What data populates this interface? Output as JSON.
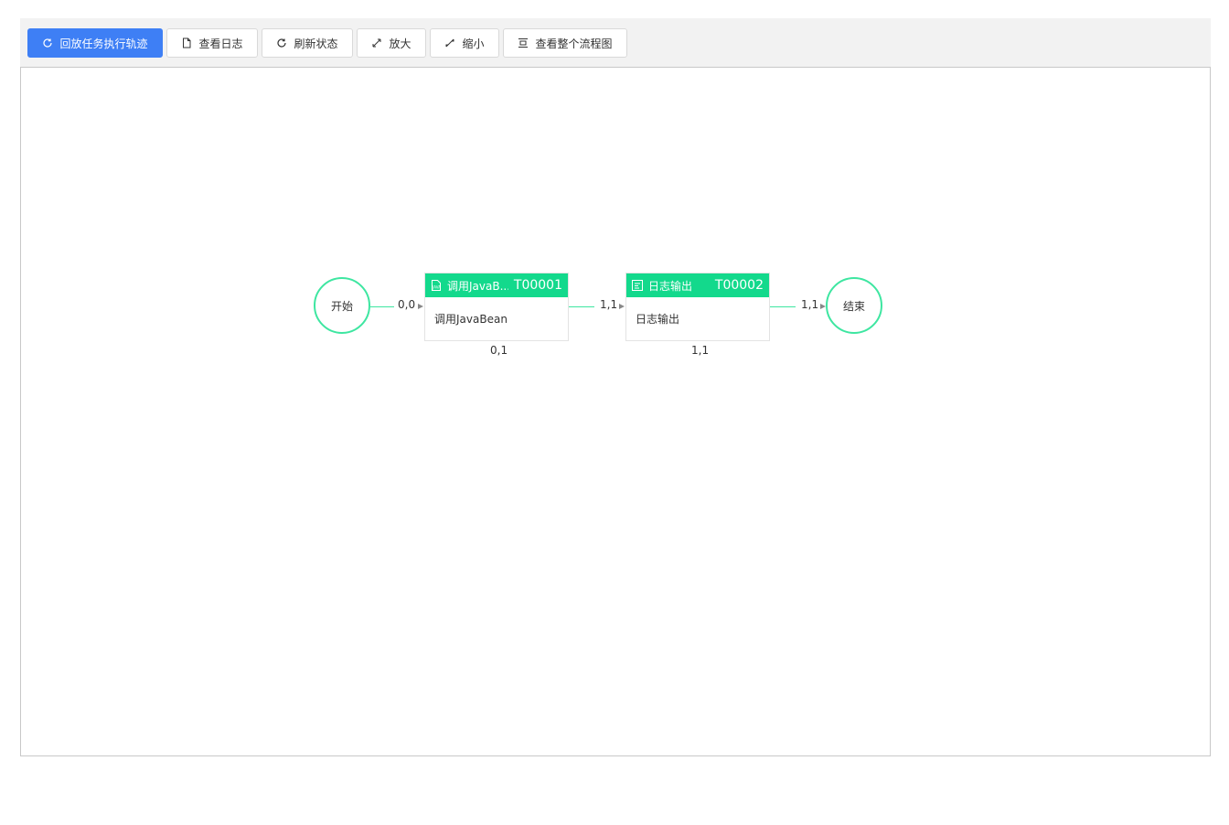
{
  "toolbar": {
    "buttons": [
      {
        "label": "回放任务执行轨迹",
        "icon": "refresh-icon",
        "primary": true
      },
      {
        "label": "查看日志",
        "icon": "document-icon"
      },
      {
        "label": "刷新状态",
        "icon": "refresh-icon"
      },
      {
        "label": "放大",
        "icon": "zoom-in-icon"
      },
      {
        "label": "缩小",
        "icon": "zoom-out-icon"
      },
      {
        "label": "查看整个流程图",
        "icon": "fit-view-icon"
      }
    ]
  },
  "flow": {
    "start": {
      "label": "开始"
    },
    "end": {
      "label": "结束"
    },
    "tasks": [
      {
        "title": "调用JavaB...",
        "code": "T00001",
        "body": "调用JavaBean",
        "icon": "java-file-icon",
        "count": "0,1"
      },
      {
        "title": "日志输出",
        "code": "T00002",
        "body": "日志输出",
        "icon": "log-file-icon",
        "count": "1,1"
      }
    ],
    "edges": [
      {
        "label": "0,0"
      },
      {
        "label": "1,1"
      },
      {
        "label": "1,1"
      }
    ]
  },
  "colors": {
    "primary": "#3e7ff5",
    "node_header": "#13d98c",
    "edge": "#3ee6a1"
  }
}
